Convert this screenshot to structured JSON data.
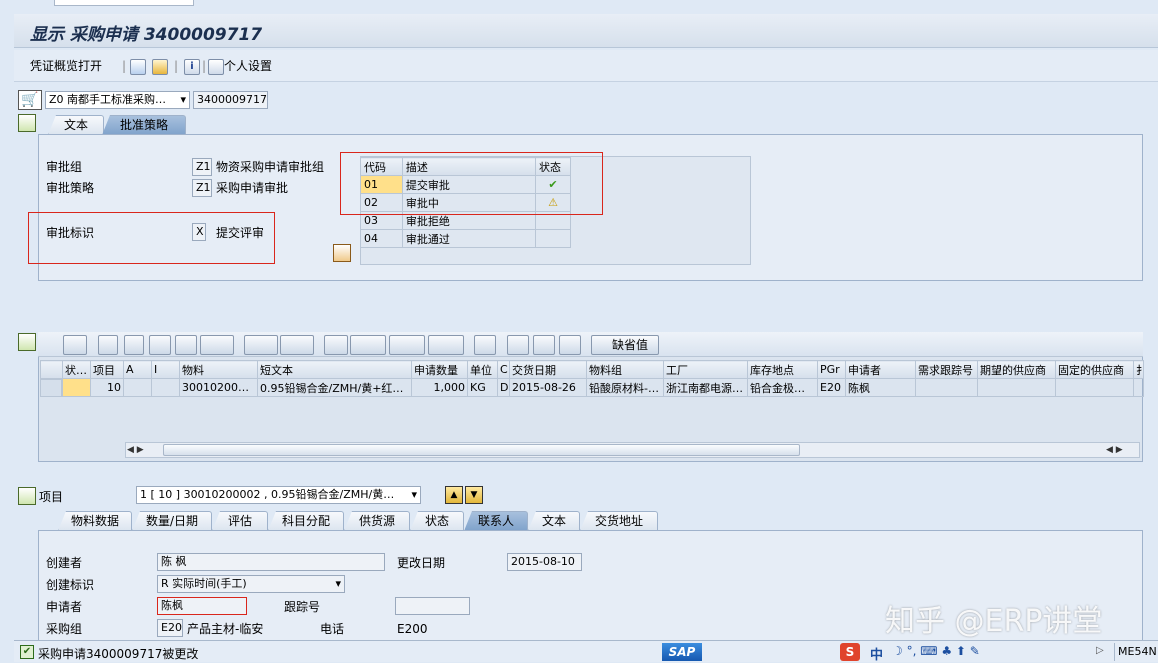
{
  "top_tab": "",
  "title": "显示 采购申请 3400009717",
  "toolbar": {
    "doc_overview": "凭证概览打开",
    "personal_settings": "个人设置"
  },
  "header": {
    "doc_type": "Z0 南都手工标准采购…",
    "doc_number": "3400009717"
  },
  "tabs_top": [
    {
      "label": "文本"
    },
    {
      "label": "批准策略"
    }
  ],
  "approval": {
    "group_label": "审批组",
    "group_code": "Z1",
    "group_text": "物资采购申请审批组",
    "strategy_label": "审批策略",
    "strategy_code": "Z1",
    "strategy_text": "采购申请审批",
    "indicator_label": "审批标识",
    "indicator_code": "X",
    "indicator_text": "提交评审"
  },
  "status_table": {
    "headers": [
      "代码",
      "描述",
      "状态"
    ],
    "rows": [
      {
        "code": "01",
        "desc": "提交审批",
        "status": "✔"
      },
      {
        "code": "02",
        "desc": "审批中",
        "status": "⚠"
      },
      {
        "code": "03",
        "desc": "审批拒绝",
        "status": ""
      },
      {
        "code": "04",
        "desc": "审批通过",
        "status": ""
      }
    ]
  },
  "items_toolbar": {
    "default_values": "缺省值"
  },
  "items_table": {
    "headers": [
      "状…",
      "项目",
      "A",
      "I",
      "物料",
      "短文本",
      "申请数量",
      "单位",
      "C",
      "交货日期",
      "物料组",
      "工厂",
      "库存地点",
      "PGr",
      "申请者",
      "需求跟踪号",
      "期望的供应商",
      "固定的供应商",
      "扌"
    ],
    "rows": [
      [
        "",
        "10",
        "",
        "",
        "300102000…",
        "0.95铅锡合金/ZMH/黄+红…",
        "1,000",
        "KG",
        "D",
        "2015-08-26",
        "铅酸原材料-…",
        "浙江南都电源…",
        "铅合金极…",
        "E20",
        "陈枫",
        "",
        "",
        "",
        ""
      ]
    ]
  },
  "item_section": {
    "label": "项目",
    "selector": "1 [ 10 ] 30010200002 , 0.95铅锡合金/ZMH/黄…"
  },
  "tabs_bottom": [
    {
      "label": "物料数据"
    },
    {
      "label": "数量/日期"
    },
    {
      "label": "评估"
    },
    {
      "label": "科目分配"
    },
    {
      "label": "供货源"
    },
    {
      "label": "状态"
    },
    {
      "label": "联系人"
    },
    {
      "label": "文本"
    },
    {
      "label": "交货地址"
    }
  ],
  "contact": {
    "creator_label": "创建者",
    "creator": "陈 枫",
    "change_date_label": "更改日期",
    "change_date": "2015-08-10",
    "create_ind_label": "创建标识",
    "create_ind": "R 实际时间(手工)",
    "requester_label": "申请者",
    "requester": "陈枫",
    "tracking_label": "跟踪号",
    "tracking": "",
    "purch_group_label": "采购组",
    "purch_group_code": "E20",
    "purch_group_text": "产品主材-临安",
    "phone_label": "电话",
    "phone": "E200"
  },
  "status_bar": {
    "message": "采购申请3400009717被更改",
    "tcode": "ME54N",
    "sap": "SAP",
    "ime": "中"
  },
  "watermark": "知乎 @ERP讲堂"
}
